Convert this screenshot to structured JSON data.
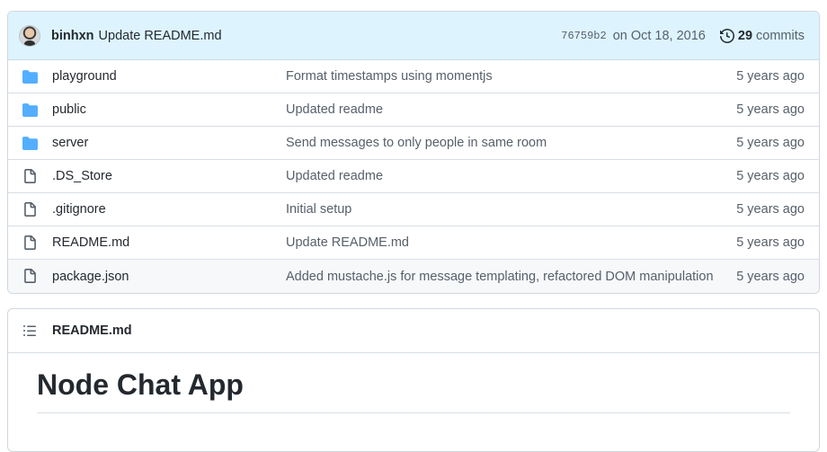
{
  "latest_commit": {
    "author": "binhxn",
    "message": "Update README.md",
    "sha": "76759b2",
    "date": "on Oct 18, 2016",
    "commit_count": "29",
    "commits_label": "commits"
  },
  "files": [
    {
      "name": "playground",
      "type": "folder",
      "message": "Format timestamps using momentjs",
      "age": "5 years ago"
    },
    {
      "name": "public",
      "type": "folder",
      "message": "Updated readme",
      "age": "5 years ago"
    },
    {
      "name": "server",
      "type": "folder",
      "message": "Send messages to only people in same room",
      "age": "5 years ago"
    },
    {
      "name": ".DS_Store",
      "type": "file",
      "message": "Updated readme",
      "age": "5 years ago"
    },
    {
      "name": ".gitignore",
      "type": "file",
      "message": "Initial setup",
      "age": "5 years ago"
    },
    {
      "name": "README.md",
      "type": "file",
      "message": "Update README.md",
      "age": "5 years ago"
    },
    {
      "name": "package.json",
      "type": "file",
      "message": "Added mustache.js for message templating, refactored DOM manipulation",
      "age": "5 years ago"
    }
  ],
  "readme": {
    "filename": "README.md",
    "heading": "Node Chat App"
  },
  "colors": {
    "folder_icon": "#54aeff",
    "file_icon": "#57606a",
    "header_bg": "#ddf4ff"
  }
}
